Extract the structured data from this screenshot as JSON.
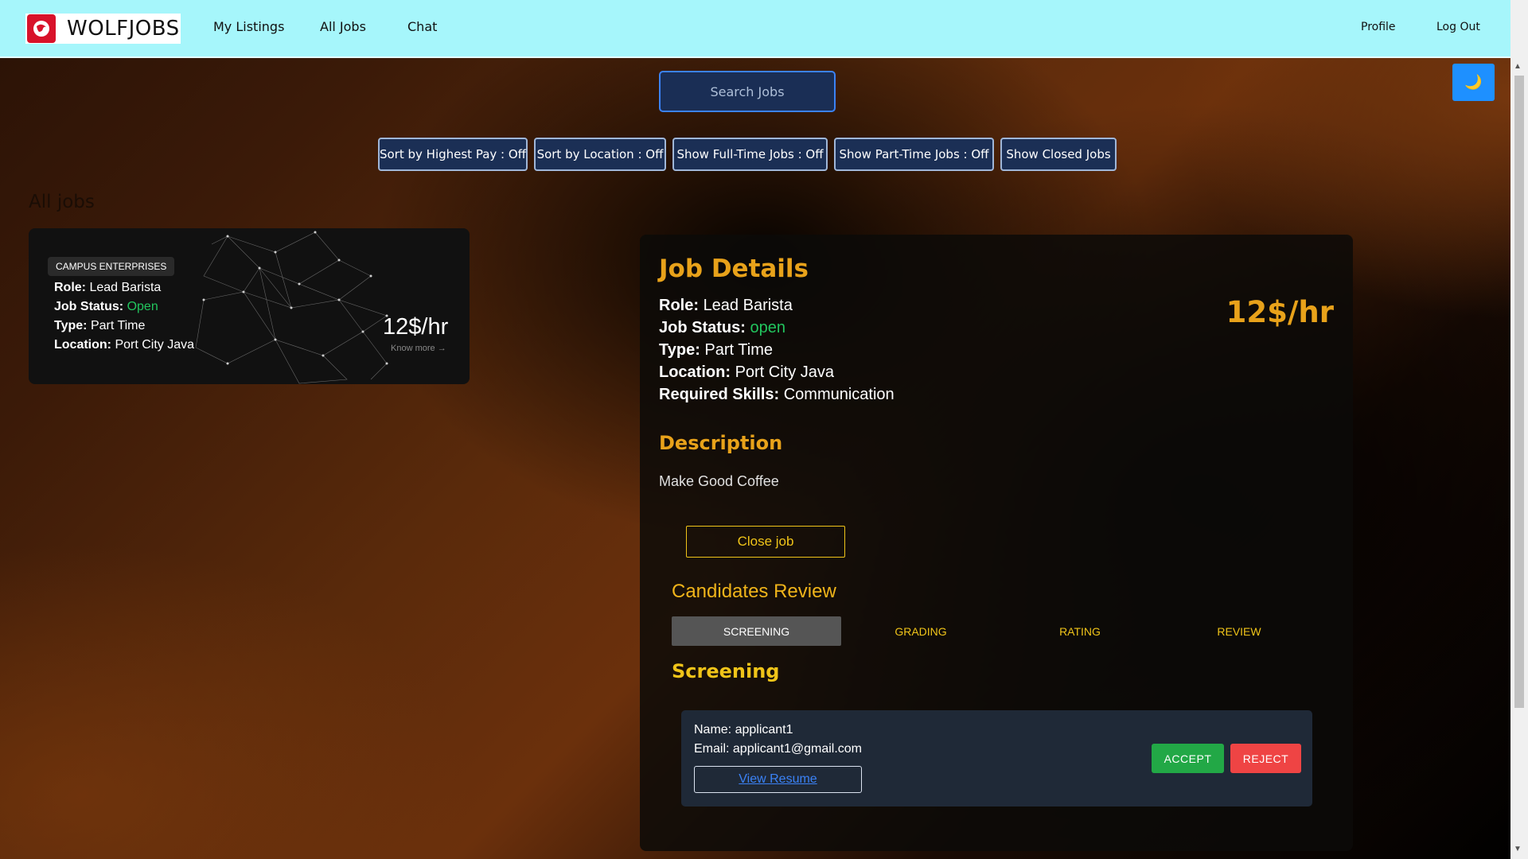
{
  "navbar": {
    "brand": "WOLFJOBS",
    "links": [
      "My Listings",
      "All Jobs",
      "Chat"
    ],
    "right_links": [
      "Profile",
      "Log Out"
    ]
  },
  "theme_toggle": {
    "icon": "moon-icon",
    "glyph": "🌙"
  },
  "search": {
    "label": "Search Jobs"
  },
  "filters": [
    "Sort by Highest Pay : Off",
    "Sort by Location : Off",
    "Show Full-Time Jobs : Off",
    "Show Part-Time Jobs : Off",
    "Show Closed Jobs"
  ],
  "list_title": "All jobs",
  "job_card": {
    "company": "CAMPUS ENTERPRISES",
    "role_label": "Role:",
    "role": "Lead Barista",
    "status_label": "Job Status:",
    "status": "Open",
    "type_label": "Type:",
    "type": "Part Time",
    "location_label": "Location:",
    "location": "Port City Java",
    "pay": "12$/hr",
    "more": "Know more →"
  },
  "details": {
    "title": "Job Details",
    "role_label": "Role:",
    "role": "Lead Barista",
    "status_label": "Job Status:",
    "status": "open",
    "type_label": "Type:",
    "type": "Part Time",
    "location_label": "Location:",
    "location": "Port City Java",
    "skills_label": "Required Skills:",
    "skills": "Communication",
    "pay": "12$/hr",
    "description_title": "Description",
    "description": "Make Good Coffee",
    "close_button": "Close job",
    "candidates_title": "Candidates Review",
    "tabs": [
      "SCREENING",
      "GRADING",
      "RATING",
      "REVIEW"
    ],
    "active_tab": "SCREENING",
    "section_title": "Screening",
    "applicant": {
      "name_label": "Name:",
      "name": "applicant1",
      "email_label": "Email:",
      "email": "applicant1@gmail.com",
      "resume_link": "View Resume",
      "accept": "ACCEPT",
      "reject": "REJECT"
    }
  },
  "colors": {
    "navbar": "#a6f6fb",
    "accent": "#e8a21a",
    "status_open": "#22c55e",
    "accept": "#22a846",
    "reject": "#ef4444"
  }
}
